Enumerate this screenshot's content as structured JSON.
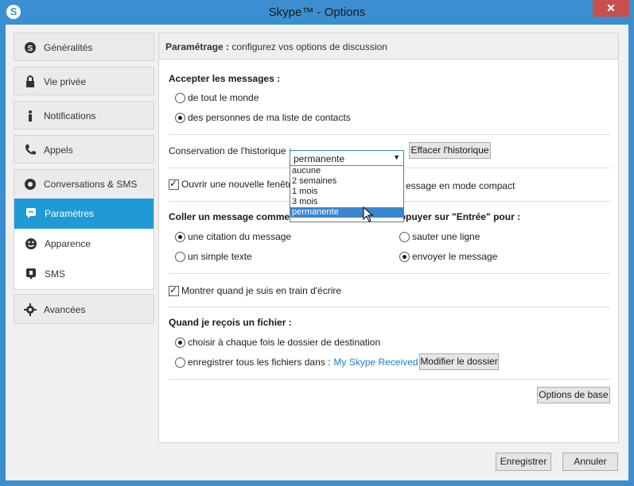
{
  "window": {
    "title": "Skype™ - Options",
    "close_glyph": "✕"
  },
  "sidebar": {
    "items": [
      {
        "label": "Généralités",
        "icon": "skype-icon"
      },
      {
        "label": "Vie privée",
        "icon": "lock-icon"
      },
      {
        "label": "Notifications",
        "icon": "info-icon"
      },
      {
        "label": "Appels",
        "icon": "phone-icon"
      },
      {
        "label": "Conversations & SMS",
        "icon": "chat-gear-icon"
      },
      {
        "label": "Avancées",
        "icon": "gear-icon"
      }
    ],
    "subitems": [
      {
        "label": "Paramètres",
        "icon": "chat-bubble-icon",
        "active": true
      },
      {
        "label": "Apparence",
        "icon": "smiley-icon",
        "active": false
      },
      {
        "label": "SMS",
        "icon": "sms-icon",
        "active": false
      }
    ]
  },
  "panel": {
    "header_bold": "Paramétrage :",
    "header_text": " configurez vos options de discussion",
    "accept": {
      "title": "Accepter les messages :",
      "options": [
        "de tout le monde",
        "des personnes de ma liste de contacts"
      ],
      "selected": 1
    },
    "history": {
      "label": "Conservation de l'historique :",
      "value": "permanente",
      "options": [
        "aucune",
        "2 semaines",
        "1 mois",
        "3 mois",
        "permanente"
      ],
      "clear_button": "Effacer l'historique"
    },
    "open_window": {
      "label_left": "Ouvrir une nouvelle fenêtre",
      "label_right": "essage en mode compact",
      "checked": true
    },
    "paste": {
      "title": "Coller un message comme :",
      "options": [
        "une citation du message",
        "un simple texte"
      ],
      "selected": 0
    },
    "enter": {
      "title": "Appuyer sur \"Entrée\" pour :",
      "options": [
        "sauter une ligne",
        "envoyer le message"
      ],
      "selected": 1
    },
    "typing": {
      "label": "Montrer quand je suis en train d'écrire",
      "checked": true
    },
    "file": {
      "title": "Quand je reçois un fichier :",
      "option1": "choisir à chaque fois le dossier de destination",
      "option2": "enregistrer tous les fichiers dans :",
      "folder_link": "My Skype Received Files",
      "change_button": "Modifier le dossier",
      "selected": 0
    },
    "basic_options_button": "Options de base"
  },
  "footer": {
    "save": "Enregistrer",
    "cancel": "Annuler"
  },
  "colors": {
    "accent": "#1f9ad6",
    "titlebar": "#3b8fd0",
    "close": "#c7504f",
    "link": "#1f7cc8"
  }
}
